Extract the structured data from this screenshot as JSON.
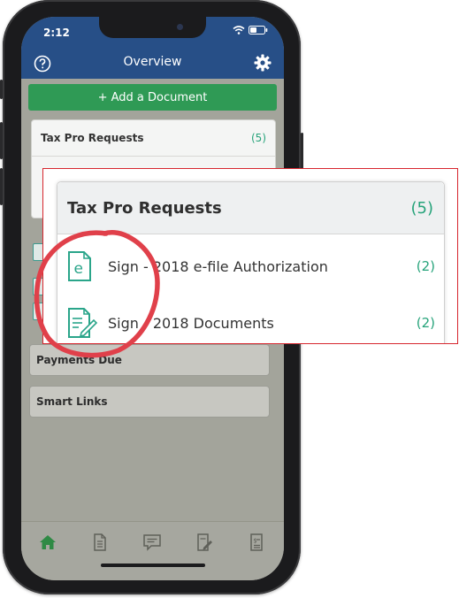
{
  "status_bar": {
    "time": "2:12"
  },
  "header": {
    "title": "Overview"
  },
  "add_button": {
    "label": "+ Add a Document"
  },
  "tax_pro_card": {
    "title": "Tax Pro Requests",
    "count": "(5)"
  },
  "sections": [
    {
      "label": "Payments Due"
    },
    {
      "label": "Smart Links"
    }
  ],
  "callout": {
    "title": "Tax Pro Requests",
    "count": "(5)",
    "items": [
      {
        "label": "Sign - 2018 e-file Authorization",
        "count": "(2)",
        "icon": "e-file-icon"
      },
      {
        "label": "Sign - 2018 Documents",
        "count": "(2)",
        "icon": "document-sign-icon"
      }
    ]
  },
  "tabs": [
    {
      "name": "home-icon",
      "active": true
    },
    {
      "name": "document-icon",
      "active": false
    },
    {
      "name": "message-icon",
      "active": false
    },
    {
      "name": "tax-form-icon",
      "active": false
    },
    {
      "name": "invoice-icon",
      "active": false
    }
  ],
  "colors": {
    "header": "#274f87",
    "add_button": "#2f9a55",
    "accent_teal": "#26a37a",
    "highlight": "#e0404a",
    "callout_border": "#d7262e"
  }
}
